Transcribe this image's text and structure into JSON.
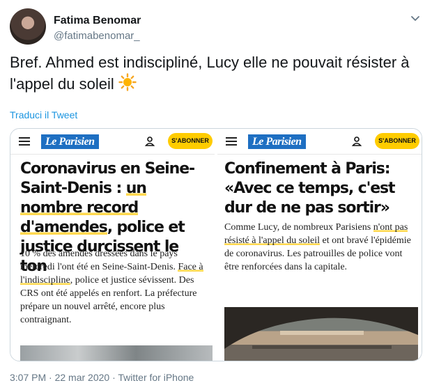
{
  "user": {
    "name": "Fatima Benomar",
    "handle": "@fatimabenomar_"
  },
  "tweet": {
    "text": "Bref. Ahmed est indiscipliné, Lucy elle ne pouvait résister à l'appel du soleil",
    "emoji": "☀️",
    "translate_label": "Traduci il Tweet",
    "footer_partial": "3:07 PM · 22 mar 2020 · Twitter for iPhone"
  },
  "left_article": {
    "brand": "Le Parisien",
    "subscribe_label": "S'ABONNER",
    "headline_a": "Coronavirus en Seine-Saint-Denis : ",
    "headline_hl1": "un nombre record",
    "headline_b": " ",
    "headline_hl2": "d'amendes",
    "headline_c": ", police et justice durcissent le ton",
    "body_a": "10 % des amendes dressées dans le pays mercredi l'ont été en Seine-Saint-Denis. ",
    "body_hl": "Face à l'indiscipline",
    "body_b": ", police et justice sévissent. Des CRS ont été appelés en renfort. La préfecture prépare un nouvel arrêté, encore plus contraignant."
  },
  "right_article": {
    "brand": "Le Parisien",
    "subscribe_label": "S'ABONNER",
    "headline": "Confinement à Paris: «Avec ce temps, c'est dur de ne pas sortir»",
    "body_a": "Comme Lucy, de nombreux Parisiens ",
    "body_hl": "n'ont pas résisté à l'appel du soleil",
    "body_b": " et ont bravé l'épidémie de coronavirus. Les patrouilles de police vont être renforcées dans la capitale."
  },
  "colors": {
    "link": "#1b95e0",
    "highlight": "#ffd84d",
    "subscribe": "#ffcc00",
    "brand_blue": "#1e6fc2"
  },
  "icons": [
    "chevron-down-icon",
    "menu-icon",
    "user-icon",
    "sun-icon"
  ]
}
